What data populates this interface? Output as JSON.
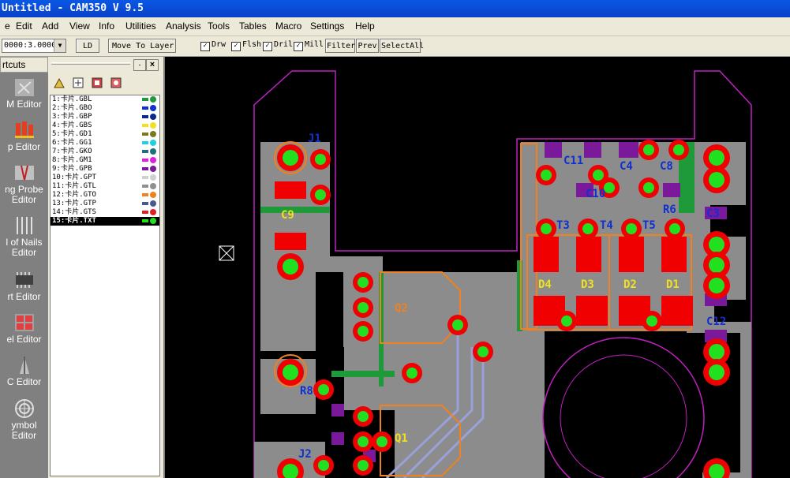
{
  "window": {
    "title": "Untitled - CAM350 V 9.5"
  },
  "menu": [
    {
      "label": "e",
      "u": ""
    },
    {
      "label": "Edit",
      "u": "E"
    },
    {
      "label": "Add",
      "u": "A"
    },
    {
      "label": "View",
      "u": "V"
    },
    {
      "label": "Info",
      "u": "I"
    },
    {
      "label": "Utilities",
      "u": "U"
    },
    {
      "label": "Analysis",
      "u": "n"
    },
    {
      "label": "Tools",
      "u": "o"
    },
    {
      "label": "Tables",
      "u": "T"
    },
    {
      "label": "Macro",
      "u": "M"
    },
    {
      "label": "Settings",
      "u": "S"
    },
    {
      "label": "Help",
      "u": "H"
    }
  ],
  "toolbar": {
    "ratio_value": "0000:3.0000",
    "ld_label": "LD",
    "move_to_layer_label": "Move To Layer",
    "checks": [
      {
        "label": "Drw",
        "checked": true
      },
      {
        "label": "Flsh",
        "checked": true
      },
      {
        "label": "Dril",
        "checked": true
      },
      {
        "label": "Mill",
        "checked": true
      }
    ],
    "filter_label": "Filter",
    "prev_label": "Prev",
    "select_all_label": "SelectAll"
  },
  "shortcuts": {
    "header": "rtcuts",
    "items": [
      {
        "label": "M Editor",
        "icon": "cam-editor-icon"
      },
      {
        "label": "p Editor",
        "icon": "cap-editor-icon"
      },
      {
        "label": "ng Probe Editor",
        "icon": "flying-probe-icon"
      },
      {
        "label": "l of Nails Editor",
        "icon": "bed-of-nails-icon"
      },
      {
        "label": "rt Editor",
        "icon": "part-editor-icon"
      },
      {
        "label": "el Editor",
        "icon": "panel-editor-icon"
      },
      {
        "label": "C Editor",
        "icon": "nc-editor-icon"
      },
      {
        "label": "ymbol Editor",
        "icon": "symbol-editor-icon"
      }
    ]
  },
  "layers": [
    {
      "label": "1:卡片.GBL",
      "color": "#1f9a3a"
    },
    {
      "label": "2:卡片.GBO",
      "color": "#1030d0"
    },
    {
      "label": "3:卡片.GBP",
      "color": "#0a2a8a"
    },
    {
      "label": "4:卡片.GBS",
      "color": "#f0e020"
    },
    {
      "label": "5:卡片.GD1",
      "color": "#7a7a20"
    },
    {
      "label": "6:卡片.GG1",
      "color": "#20d0e0"
    },
    {
      "label": "7:卡片.GKO",
      "color": "#20707a"
    },
    {
      "label": "8:卡片.GM1",
      "color": "#e020e0"
    },
    {
      "label": "9:卡片.GPB",
      "color": "#7a1a9a"
    },
    {
      "label": "10:卡片.GPT",
      "color": "#d0d0d0"
    },
    {
      "label": "11:卡片.GTL",
      "color": "#909090"
    },
    {
      "label": "12:卡片.GTO",
      "color": "#f08020"
    },
    {
      "label": "13:卡片.GTP",
      "color": "#4a5a8a"
    },
    {
      "label": "14:卡片.GTS",
      "color": "#e02020"
    },
    {
      "label": "15:卡片.TXT",
      "color": "#20e020",
      "active": true
    }
  ],
  "pcb": {
    "refs": [
      "C9",
      "Q2",
      "Q1",
      "D4",
      "D3",
      "D2",
      "D1",
      "C11",
      "C10",
      "C12",
      "C3",
      "C4",
      "C8",
      "T3",
      "T4",
      "T5",
      "R6",
      "R8",
      "J1",
      "J2"
    ]
  }
}
